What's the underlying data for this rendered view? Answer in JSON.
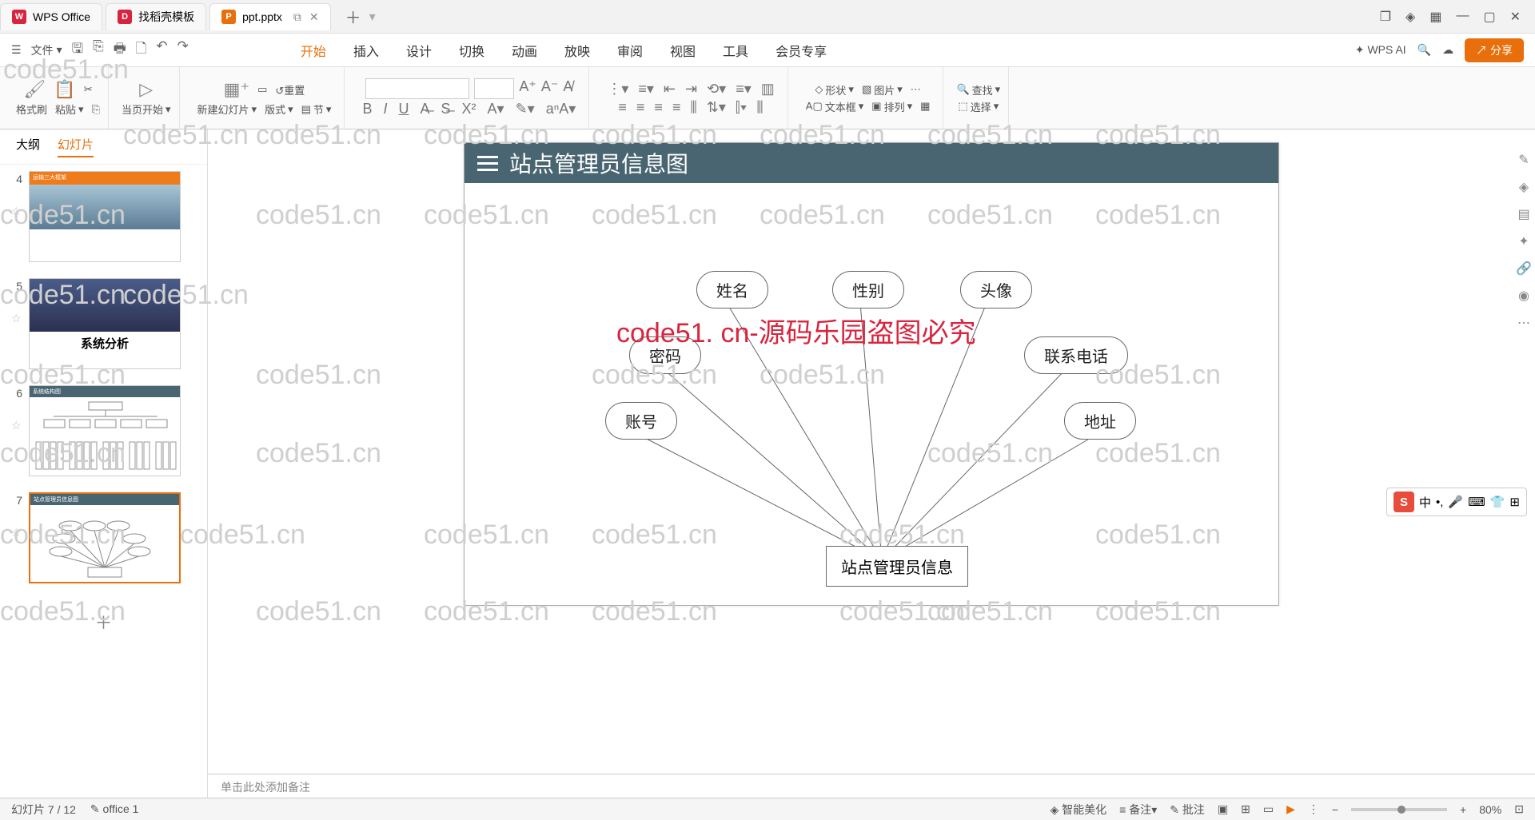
{
  "tabs": {
    "wps": "WPS Office",
    "templates": "找稻壳模板",
    "file": "ppt.pptx"
  },
  "menu": {
    "file": "文件"
  },
  "ribbon_tabs": [
    "开始",
    "插入",
    "设计",
    "切换",
    "动画",
    "放映",
    "审阅",
    "视图",
    "工具",
    "会员专享"
  ],
  "ai": "WPS AI",
  "share": "分享",
  "ribbon": {
    "format_painter": "格式刷",
    "paste": "粘贴",
    "from_current": "当页开始",
    "new_slide": "新建幻灯片",
    "layout": "版式",
    "section": "节",
    "reset": "重置",
    "shape": "形状",
    "picture": "图片",
    "textbox": "文本框",
    "arrange": "排列",
    "find": "查找",
    "select": "选择"
  },
  "side": {
    "outline": "大纲",
    "slides": "幻灯片"
  },
  "thumbs": {
    "n4": "4",
    "n5": "5",
    "n6": "6",
    "n7": "7",
    "s5_caption": "系统分析",
    "s4_hdr": "运输三大框架",
    "s6_hdr": "系统结构图",
    "s7_hdr": "站点管理员信息图"
  },
  "slide": {
    "title": "站点管理员信息图",
    "center": "站点管理员信息",
    "n1": "姓名",
    "n2": "性别",
    "n3": "头像",
    "n4": "密码",
    "n5": "联系电话",
    "n6": "账号",
    "n7": "地址"
  },
  "watermark": "code51. cn-源码乐园盗图必究",
  "wm_small": "code51.cn",
  "notes": "单击此处添加备注",
  "status": {
    "slide": "幻灯片 7 / 12",
    "office": "office 1",
    "beautify": "智能美化",
    "notes": "备注",
    "comments": "批注",
    "zoom": "80%"
  }
}
